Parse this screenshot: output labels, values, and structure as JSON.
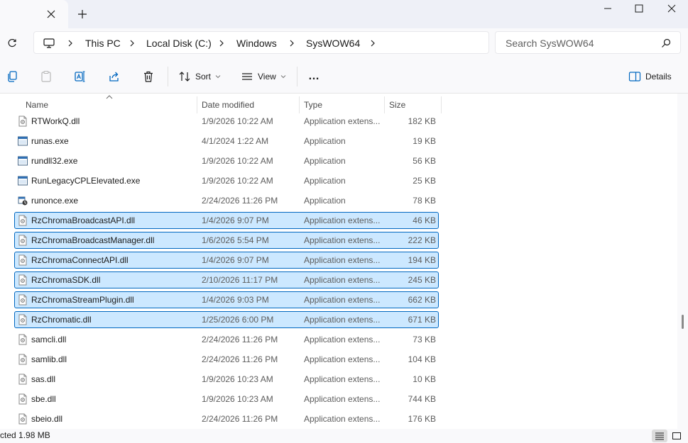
{
  "window": {
    "new_tab_symbol": "+",
    "controls": [
      "minimize-icon",
      "maximize-icon",
      "close-icon"
    ]
  },
  "address": {
    "breadcrumbs": [
      "This PC",
      "Local Disk (C:)",
      "Windows",
      "SysWOW64"
    ],
    "search_placeholder": "Search SysWOW64"
  },
  "commands": {
    "sort_label": "Sort",
    "view_label": "View",
    "more_label": "…",
    "details_label": "Details"
  },
  "columns": {
    "name": "Name",
    "date": "Date modified",
    "type": "Type",
    "size": "Size"
  },
  "files": [
    {
      "name": "RTWorkQ.dll",
      "date": "1/9/2026 10:22 AM",
      "type": "Application extens...",
      "size": "182 KB",
      "icon": "dll-icon",
      "selected": false
    },
    {
      "name": "runas.exe",
      "date": "4/1/2024 1:22 AM",
      "type": "Application",
      "size": "19 KB",
      "icon": "exe-icon",
      "selected": false
    },
    {
      "name": "rundll32.exe",
      "date": "1/9/2026 10:22 AM",
      "type": "Application",
      "size": "56 KB",
      "icon": "exe-icon",
      "selected": false
    },
    {
      "name": "RunLegacyCPLElevated.exe",
      "date": "1/9/2026 10:22 AM",
      "type": "Application",
      "size": "25 KB",
      "icon": "exe-icon",
      "selected": false
    },
    {
      "name": "runonce.exe",
      "date": "2/24/2026 11:26 PM",
      "type": "Application",
      "size": "78 KB",
      "icon": "runonce-icon",
      "selected": false
    },
    {
      "name": "RzChromaBroadcastAPI.dll",
      "date": "1/4/2026 9:07 PM",
      "type": "Application extens...",
      "size": "46 KB",
      "icon": "dll-icon",
      "selected": true
    },
    {
      "name": "RzChromaBroadcastManager.dll",
      "date": "1/6/2026 5:54 PM",
      "type": "Application extens...",
      "size": "222 KB",
      "icon": "dll-icon",
      "selected": true
    },
    {
      "name": "RzChromaConnectAPI.dll",
      "date": "1/4/2026 9:07 PM",
      "type": "Application extens...",
      "size": "194 KB",
      "icon": "dll-icon",
      "selected": true
    },
    {
      "name": "RzChromaSDK.dll",
      "date": "2/10/2026 11:17 PM",
      "type": "Application extens...",
      "size": "245 KB",
      "icon": "dll-icon",
      "selected": true
    },
    {
      "name": "RzChromaStreamPlugin.dll",
      "date": "1/4/2026 9:03 PM",
      "type": "Application extens...",
      "size": "662 KB",
      "icon": "dll-icon",
      "selected": true
    },
    {
      "name": "RzChromatic.dll",
      "date": "1/25/2026 6:00 PM",
      "type": "Application extens...",
      "size": "671 KB",
      "icon": "dll-icon",
      "selected": true
    },
    {
      "name": "samcli.dll",
      "date": "2/24/2026 11:26 PM",
      "type": "Application extens...",
      "size": "73 KB",
      "icon": "dll-icon",
      "selected": false
    },
    {
      "name": "samlib.dll",
      "date": "2/24/2026 11:26 PM",
      "type": "Application extens...",
      "size": "104 KB",
      "icon": "dll-icon",
      "selected": false
    },
    {
      "name": "sas.dll",
      "date": "1/9/2026 10:23 AM",
      "type": "Application extens...",
      "size": "10 KB",
      "icon": "dll-icon",
      "selected": false
    },
    {
      "name": "sbe.dll",
      "date": "1/9/2026 10:23 AM",
      "type": "Application extens...",
      "size": "744 KB",
      "icon": "dll-icon",
      "selected": false
    },
    {
      "name": "sbeio.dll",
      "date": "2/24/2026 11:26 PM",
      "type": "Application extens...",
      "size": "176 KB",
      "icon": "dll-icon",
      "selected": false
    }
  ],
  "status": {
    "text": "cted  1.98 MB"
  },
  "colors": {
    "accent": "#0067c0",
    "selection": "#cce8ff",
    "chrome": "#f9f9fb"
  }
}
